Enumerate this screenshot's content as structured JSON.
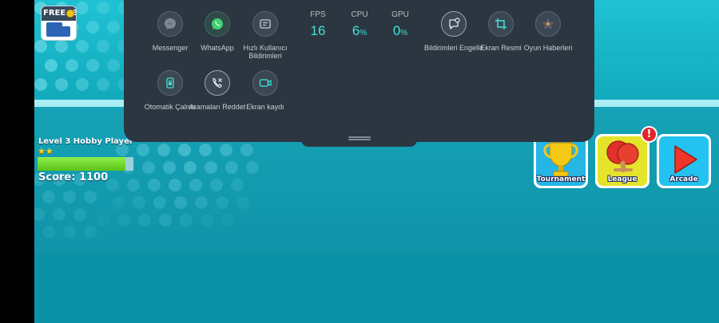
{
  "game": {
    "free_button": {
      "label": "FREE+3"
    },
    "player": {
      "level_label": "Level 3 Hobby Player",
      "stars": "★★",
      "xp_progress": 0.92,
      "score_label": "Score: 1100"
    },
    "modes": [
      {
        "label": "Tournament",
        "icon": "trophy-icon",
        "color": "#25b6e6"
      },
      {
        "label": "League",
        "icon": "paddle-icon",
        "color": "#e5e32a",
        "alert": "!"
      },
      {
        "label": "Arcade",
        "icon": "play-icon",
        "color": "#22c3f0"
      }
    ],
    "colors": {
      "background": "#0c97ad",
      "accent_green": "#7bdc35",
      "alert_red": "#e3242b"
    }
  },
  "overlay": {
    "apps": [
      {
        "label": "Messenger",
        "icon": "messenger-icon"
      },
      {
        "label": "WhatsApp",
        "icon": "whatsapp-icon"
      },
      {
        "label": "Hızlı Kullanıcı Bildirimleri",
        "icon": "quick-reply-icon"
      },
      {
        "label": "Bildirimleri Engelle",
        "icon": "block-notifications-icon"
      },
      {
        "label": "Ekran Resmi",
        "icon": "screenshot-crop-icon"
      },
      {
        "label": "Oyun Haberleri",
        "icon": "game-news-icon"
      },
      {
        "label": "Otomatik Çalma",
        "icon": "auto-play-icon"
      },
      {
        "label": "Aramaları Reddet",
        "icon": "reject-calls-icon"
      },
      {
        "label": "Ekran kaydı",
        "icon": "screen-record-icon"
      }
    ],
    "stats": [
      {
        "label": "FPS",
        "value": "16",
        "unit": ""
      },
      {
        "label": "CPU",
        "value": "6",
        "unit": "%"
      },
      {
        "label": "GPU",
        "value": "0",
        "unit": "%"
      }
    ],
    "colors": {
      "panel": "#2b3641",
      "stat_value": "#43e2d7"
    }
  }
}
